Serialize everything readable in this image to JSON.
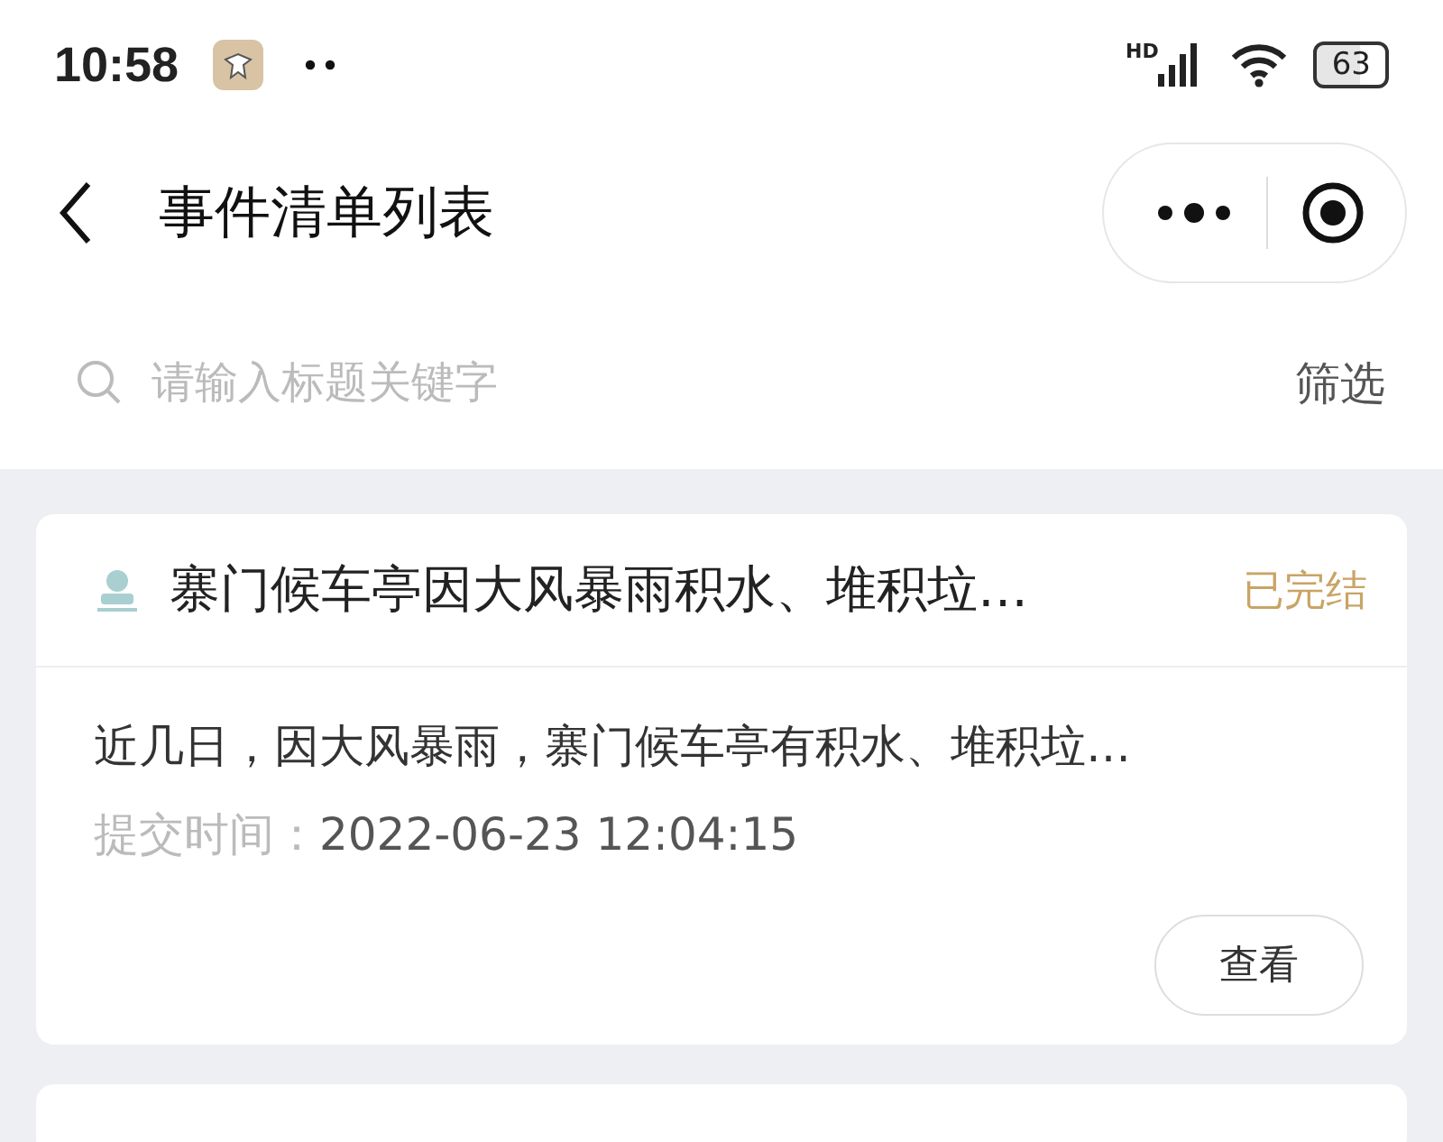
{
  "status_bar": {
    "time": "10:58",
    "network": "HD",
    "battery": "63"
  },
  "nav": {
    "title": "事件清单列表"
  },
  "search": {
    "placeholder": "请输入标题关键字",
    "filter_label": "筛选"
  },
  "events": [
    {
      "title": "寨门候车亭因大风暴雨积水、堆积垃…",
      "status": "已完结",
      "summary": "近几日，因大风暴雨，寨门候车亭有积水、堆积垃…",
      "time_label": "提交时间：",
      "time": "2022-06-23 12:04:15",
      "action": "查看"
    },
    {
      "kind": "partial"
    }
  ]
}
